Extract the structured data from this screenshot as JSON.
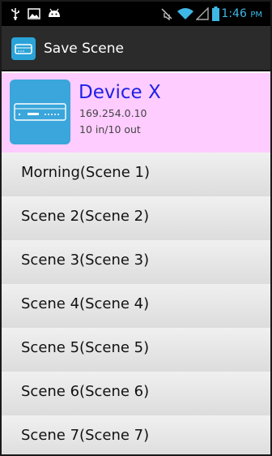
{
  "status_bar": {
    "time": "1:46",
    "ampm": "PM",
    "icons": [
      "usb-icon",
      "image-icon",
      "android-icon",
      "mute-icon",
      "wifi-icon",
      "signal-icon",
      "battery-icon"
    ]
  },
  "action_bar": {
    "title": "Save Scene",
    "icon": "app-device-icon"
  },
  "device": {
    "name": "Device X",
    "ip": "169.254.0.10",
    "io": "10 in/10 out",
    "colors": {
      "header_bg": "#ffccff",
      "name": "#1f1fe6"
    }
  },
  "scenes": [
    {
      "label": "Morning(Scene 1)"
    },
    {
      "label": "Scene 2(Scene 2)"
    },
    {
      "label": "Scene 3(Scene 3)"
    },
    {
      "label": "Scene 4(Scene 4)"
    },
    {
      "label": "Scene 5(Scene 5)"
    },
    {
      "label": "Scene 6(Scene 6)"
    },
    {
      "label": "Scene 7(Scene 7)"
    }
  ]
}
